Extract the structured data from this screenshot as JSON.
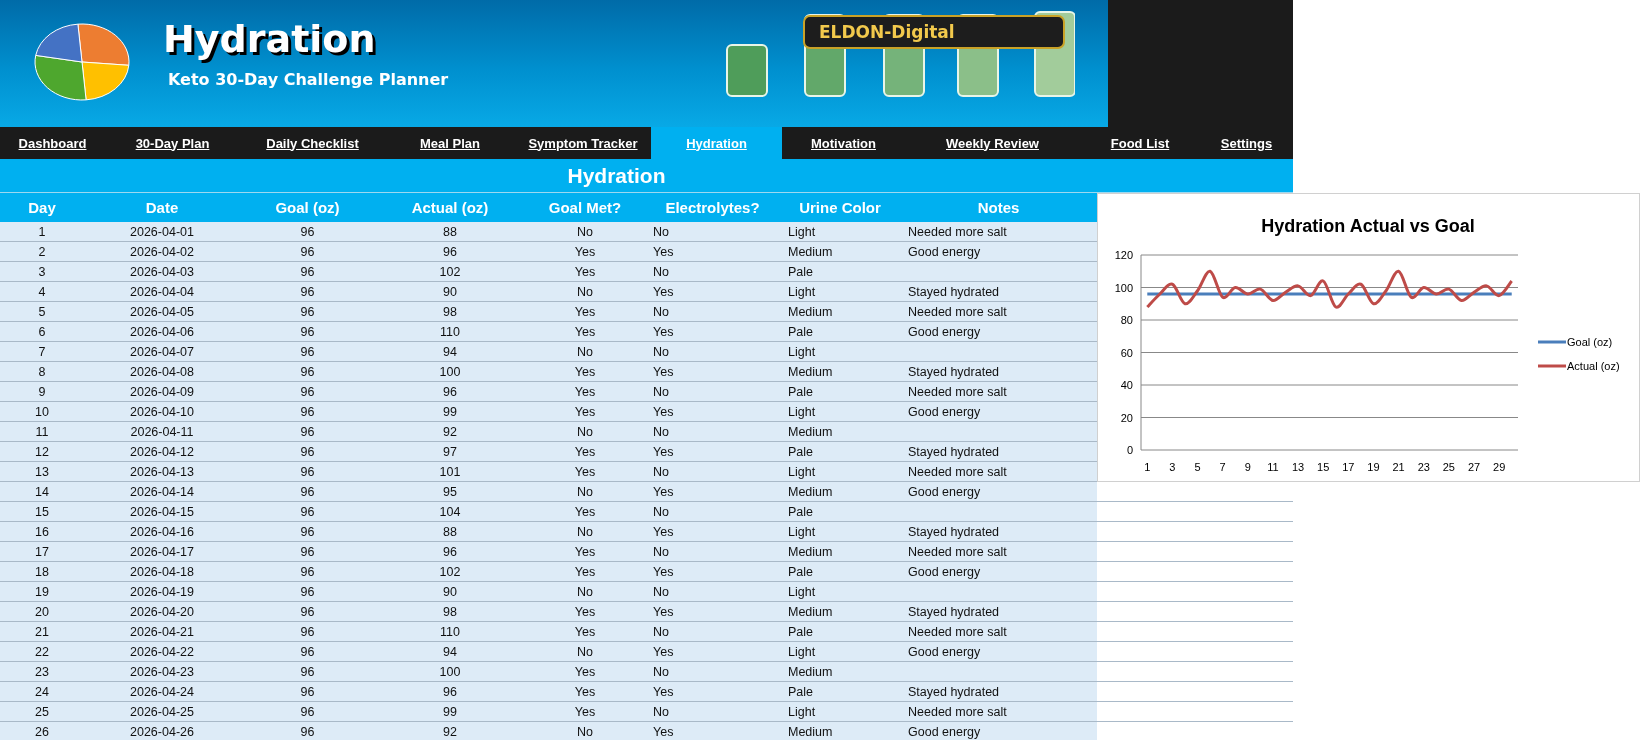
{
  "header": {
    "title": "Hydration",
    "subtitle": "Keto 30-Day Challenge Planner",
    "brand": "ELDON-Digital"
  },
  "nav": [
    {
      "label": "Dashboard",
      "selected": false
    },
    {
      "label": "30-Day Plan",
      "selected": false
    },
    {
      "label": "Daily Checklist",
      "selected": false
    },
    {
      "label": "Meal Plan",
      "selected": false
    },
    {
      "label": "Symptom Tracker",
      "selected": false
    },
    {
      "label": "Hydration",
      "selected": true
    },
    {
      "label": "Motivation",
      "selected": false
    },
    {
      "label": "Weekly Review",
      "selected": false
    },
    {
      "label": "Food List",
      "selected": false
    },
    {
      "label": "Settings",
      "selected": false
    }
  ],
  "section_title": "Hydration",
  "table": {
    "columns": [
      "Day",
      "Date",
      "Goal (oz)",
      "Actual (oz)",
      "Goal Met?",
      "Electrolytes?",
      "Urine Color",
      "Notes"
    ],
    "rows": [
      [
        "1",
        "2026-04-01",
        "96",
        "88",
        "No",
        "No",
        "Light",
        "Needed more salt"
      ],
      [
        "2",
        "2026-04-02",
        "96",
        "96",
        "Yes",
        "Yes",
        "Medium",
        "Good energy"
      ],
      [
        "3",
        "2026-04-03",
        "96",
        "102",
        "Yes",
        "No",
        "Pale"
      ],
      [
        "4",
        "2026-04-04",
        "96",
        "90",
        "No",
        "Yes",
        "Light",
        "Stayed hydrated"
      ],
      [
        "5",
        "2026-04-05",
        "96",
        "98",
        "Yes",
        "No",
        "Medium",
        "Needed more salt"
      ],
      [
        "6",
        "2026-04-06",
        "96",
        "110",
        "Yes",
        "Yes",
        "Pale",
        "Good energy"
      ],
      [
        "7",
        "2026-04-07",
        "96",
        "94",
        "No",
        "No",
        "Light"
      ],
      [
        "8",
        "2026-04-08",
        "96",
        "100",
        "Yes",
        "Yes",
        "Medium",
        "Stayed hydrated"
      ],
      [
        "9",
        "2026-04-09",
        "96",
        "96",
        "Yes",
        "No",
        "Pale",
        "Needed more salt"
      ],
      [
        "10",
        "2026-04-10",
        "96",
        "99",
        "Yes",
        "Yes",
        "Light",
        "Good energy"
      ],
      [
        "11",
        "2026-04-11",
        "96",
        "92",
        "No",
        "No",
        "Medium"
      ],
      [
        "12",
        "2026-04-12",
        "96",
        "97",
        "Yes",
        "Yes",
        "Pale",
        "Stayed hydrated"
      ],
      [
        "13",
        "2026-04-13",
        "96",
        "101",
        "Yes",
        "No",
        "Light",
        "Needed more salt"
      ],
      [
        "14",
        "2026-04-14",
        "96",
        "95",
        "No",
        "Yes",
        "Medium",
        "Good energy"
      ],
      [
        "15",
        "2026-04-15",
        "96",
        "104",
        "Yes",
        "No",
        "Pale"
      ],
      [
        "16",
        "2026-04-16",
        "96",
        "88",
        "No",
        "Yes",
        "Light",
        "Stayed hydrated"
      ],
      [
        "17",
        "2026-04-17",
        "96",
        "96",
        "Yes",
        "No",
        "Medium",
        "Needed more salt"
      ],
      [
        "18",
        "2026-04-18",
        "96",
        "102",
        "Yes",
        "Yes",
        "Pale",
        "Good energy"
      ],
      [
        "19",
        "2026-04-19",
        "96",
        "90",
        "No",
        "No",
        "Light"
      ],
      [
        "20",
        "2026-04-20",
        "96",
        "98",
        "Yes",
        "Yes",
        "Medium",
        "Stayed hydrated"
      ],
      [
        "21",
        "2026-04-21",
        "96",
        "110",
        "Yes",
        "No",
        "Pale",
        "Needed more salt"
      ],
      [
        "22",
        "2026-04-22",
        "96",
        "94",
        "No",
        "Yes",
        "Light",
        "Good energy"
      ],
      [
        "23",
        "2026-04-23",
        "96",
        "100",
        "Yes",
        "No",
        "Medium"
      ],
      [
        "24",
        "2026-04-24",
        "96",
        "96",
        "Yes",
        "Yes",
        "Pale",
        "Stayed hydrated"
      ],
      [
        "25",
        "2026-04-25",
        "96",
        "99",
        "Yes",
        "No",
        "Light",
        "Needed more salt"
      ],
      [
        "26",
        "2026-04-26",
        "96",
        "92",
        "No",
        "Yes",
        "Medium",
        "Good energy"
      ]
    ]
  },
  "chart": {
    "chart_data": {
      "type": "line",
      "title": "Hydration Actual vs Goal",
      "x": [
        1,
        2,
        3,
        4,
        5,
        6,
        7,
        8,
        9,
        10,
        11,
        12,
        13,
        14,
        15,
        16,
        17,
        18,
        19,
        20,
        21,
        22,
        23,
        24,
        25,
        26,
        27,
        28,
        29,
        30
      ],
      "xlim": [
        0.5,
        30.5
      ],
      "ylim": [
        0,
        120
      ],
      "grid": true,
      "legend": "right",
      "yticks": [
        {
          "value": 0,
          "label": "0"
        },
        {
          "value": 20,
          "label": "20"
        },
        {
          "value": 40,
          "label": "40"
        },
        {
          "value": 60,
          "label": "60"
        },
        {
          "value": 80,
          "label": "80"
        },
        {
          "value": 100,
          "label": "100"
        },
        {
          "value": 120,
          "label": "120"
        }
      ],
      "xticks": [
        {
          "value": 1,
          "label": "1"
        },
        {
          "value": 3,
          "label": "3"
        },
        {
          "value": 5,
          "label": "5"
        },
        {
          "value": 7,
          "label": "7"
        },
        {
          "value": 9,
          "label": "9"
        },
        {
          "value": 11,
          "label": "11"
        },
        {
          "value": 13,
          "label": "13"
        },
        {
          "value": 15,
          "label": "15"
        },
        {
          "value": 17,
          "label": "17"
        },
        {
          "value": 19,
          "label": "19"
        },
        {
          "value": 21,
          "label": "21"
        },
        {
          "value": 23,
          "label": "23"
        },
        {
          "value": 25,
          "label": "25"
        },
        {
          "value": 27,
          "label": "27"
        },
        {
          "value": 29,
          "label": "29"
        }
      ],
      "series": [
        {
          "name": "Goal (oz)",
          "color": "#4a7ebb",
          "values": [
            96,
            96,
            96,
            96,
            96,
            96,
            96,
            96,
            96,
            96,
            96,
            96,
            96,
            96,
            96,
            96,
            96,
            96,
            96,
            96,
            96,
            96,
            96,
            96,
            96,
            96,
            96,
            96,
            96,
            96
          ]
        },
        {
          "name": "Actual (oz)",
          "color": "#be4b48",
          "values": [
            88,
            96,
            102,
            90,
            98,
            110,
            94,
            100,
            96,
            99,
            92,
            97,
            101,
            95,
            104,
            88,
            96,
            102,
            90,
            98,
            110,
            94,
            100,
            96,
            99,
            92,
            97,
            101,
            95,
            104
          ]
        }
      ]
    }
  }
}
